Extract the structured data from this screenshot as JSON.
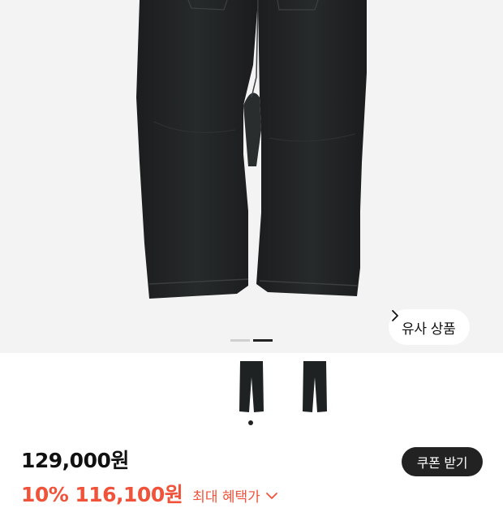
{
  "product_image": {
    "similar_button_label": "유사 상품",
    "pager": {
      "count": 2,
      "active_index": 1
    }
  },
  "thumbnails": {
    "count": 2,
    "selected_index": 0
  },
  "pricing": {
    "original_price": "129,000원",
    "discount_rate": "10%",
    "sale_price": "116,100원",
    "max_benefit_label": "최대 혜택가",
    "coupon_button_label": "쿠폰 받기"
  },
  "colors": {
    "accent": "#f0533a",
    "dark": "#222222",
    "image_background": "#f3f3f3"
  },
  "icons": {
    "similar_chevron": "chevron-right-icon",
    "benefit_chevron": "chevron-down-icon"
  }
}
